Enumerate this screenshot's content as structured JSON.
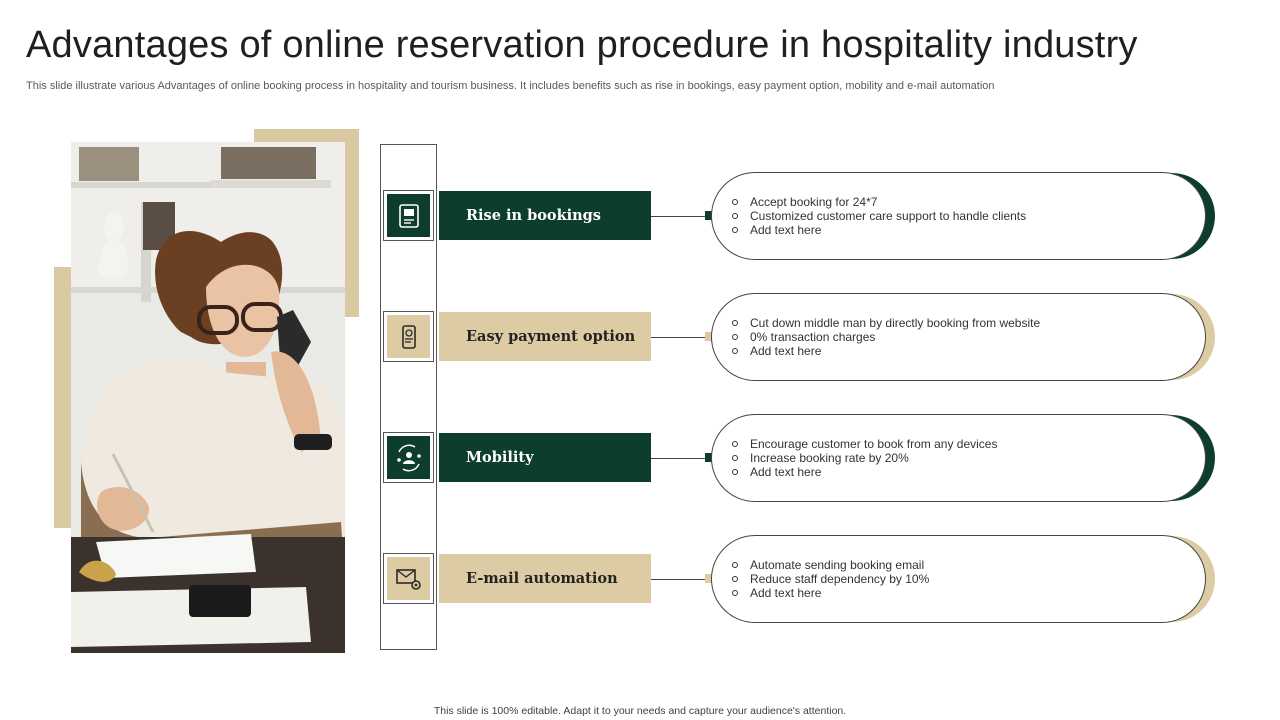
{
  "title": "Advantages of online reservation procedure in hospitality industry",
  "subtitle": "This slide illustrate various Advantages of online booking process in hospitality and tourism business. It includes benefits such as rise in bookings, easy payment option, mobility and e-mail automation",
  "footer": "This slide is 100% editable. Adapt it to your needs and capture your audience's attention.",
  "colors": {
    "green": "#0d3d2d",
    "tan": "#ddcba3",
    "deco": "#d9c9a1"
  },
  "items": [
    {
      "label": "Rise in bookings",
      "icon": "booking-calendar-icon",
      "style": "green",
      "points": [
        "Accept booking for 24*7",
        "Customized customer care support to handle clients",
        "Add text here"
      ]
    },
    {
      "label": "Easy payment option",
      "icon": "mobile-payment-icon",
      "style": "tan",
      "points": [
        "Cut down middle man by directly booking from website",
        "0% transaction charges",
        "Add text here"
      ]
    },
    {
      "label": "Mobility",
      "icon": "mobility-people-icon",
      "style": "green",
      "points": [
        "Encourage customer to book from any devices",
        "Increase booking rate by 20%",
        "Add text here"
      ]
    },
    {
      "label": "E-mail automation",
      "icon": "email-gear-icon",
      "style": "tan",
      "points": [
        "Automate sending booking email",
        "Reduce staff dependency by 10%",
        "Add text here"
      ]
    }
  ]
}
